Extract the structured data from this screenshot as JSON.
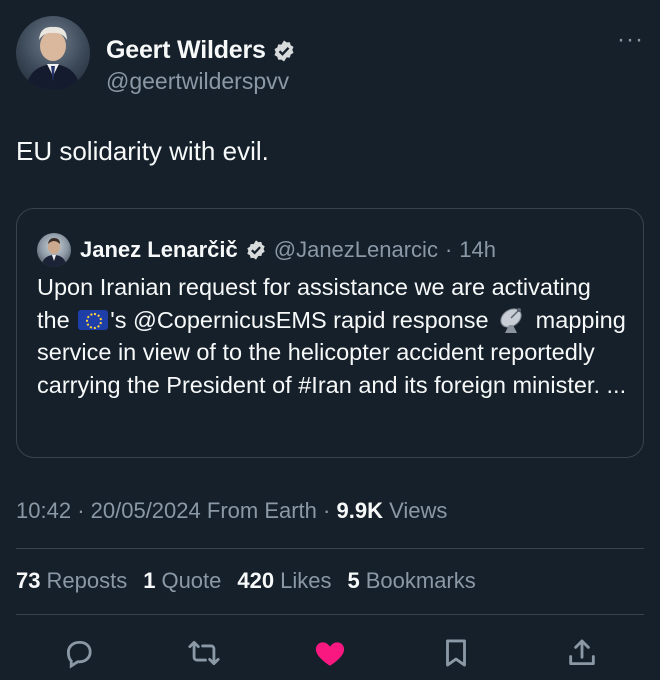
{
  "author": {
    "name": "Geert Wilders",
    "handle": "@geertwilderspvv"
  },
  "more_label": "···",
  "tweet_text": "EU solidarity with evil.",
  "quoted": {
    "name": "Janez Lenarčič",
    "handle": "@JanezLenarcic",
    "separator": "·",
    "time": "14h",
    "text_part1": "Upon Iranian request for assistance we are activating the",
    "text_part2": "'s @CopernicusEMS rapid response",
    "text_part3": "mapping service in view of to the helicopter accident reportedly carrying the President of #Iran and its foreign minister. ..."
  },
  "meta": {
    "time": "10:42",
    "sep1": "·",
    "date": "20/05/2024",
    "source": "From Earth",
    "sep2": "·",
    "views_count": "9.9K",
    "views_label": "Views"
  },
  "stats": {
    "reposts_count": "73",
    "reposts_label": "Reposts",
    "quotes_count": "1",
    "quotes_label": "Quote",
    "likes_count": "420",
    "likes_label": "Likes",
    "bookmarks_count": "5",
    "bookmarks_label": "Bookmarks"
  },
  "colors": {
    "background": "#15202b",
    "text": "#f7f9f9",
    "secondary": "#8b98a5",
    "verified": "#1d9bf0",
    "like": "#f91880"
  },
  "icons": [
    "reply-icon",
    "repost-icon",
    "like-icon",
    "bookmark-icon",
    "share-icon"
  ]
}
